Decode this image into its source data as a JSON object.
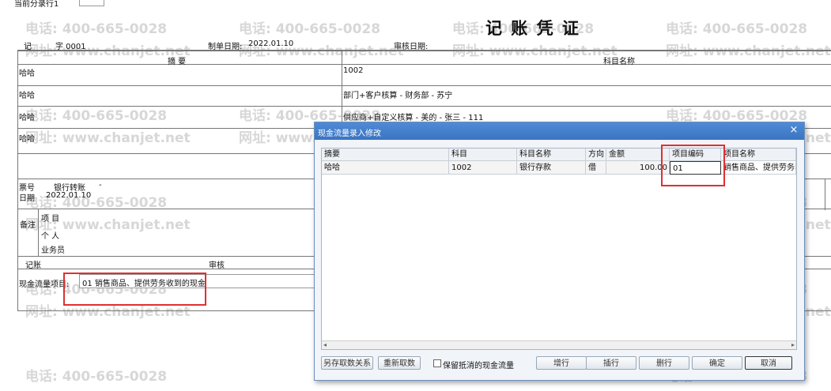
{
  "top_label": "当前分录行1",
  "voucher": {
    "title": "记 账 凭 证",
    "type_label": "记",
    "number_label": "字 0001",
    "date_label": "制单日期:",
    "date_value": "2022.01.10",
    "audit_date_label": "审核日期:",
    "col_summary": "摘 要",
    "col_account": "科目名称",
    "rows": [
      {
        "summary": "哈哈",
        "account": "1002"
      },
      {
        "summary": "哈哈",
        "account": "部门+客户核算 - 财务部 - 苏宁"
      },
      {
        "summary": "哈哈",
        "account": "供应商+自定义核算 - 美的 - 张三 - 111"
      },
      {
        "summary": "哈哈",
        "account": ""
      }
    ],
    "ticket_label": "票号",
    "ticket_value": "银行转账",
    "ticket_dash": "-",
    "date2_label": "日期",
    "date2_value": "2022.01.10",
    "remark_label": "备注",
    "project_label": "项 目",
    "person_label": "个 人",
    "salesman_label": "业务员",
    "bookkeeping_label": "记账",
    "audit_label": "审核",
    "cashflow_label": "现金流量项目:",
    "cashflow_value": "01 销售商品、提供劳务收到的现金"
  },
  "watermark": {
    "phone": "电话: 400-665-0028",
    "site": "网址: www.chanjet.net"
  },
  "dialog": {
    "title": "现金流量录入修改",
    "close": "×",
    "headers": [
      "摘要",
      "科目",
      "科目名称",
      "方向",
      "金额",
      "项目编码",
      "项目名称"
    ],
    "row": {
      "summary": "哈哈",
      "account": "1002",
      "account_name": "银行存款",
      "direction": "借",
      "amount": "100.00",
      "item_code": "01",
      "item_name": "销售商品、提供劳务收"
    },
    "buttons": {
      "save_relation": "另存取数关系",
      "refetch": "重新取数",
      "keep_offset": "保留抵消的现金流量",
      "add": "增行",
      "insert": "插行",
      "delete": "删行",
      "ok": "确定",
      "cancel": "取消"
    }
  }
}
